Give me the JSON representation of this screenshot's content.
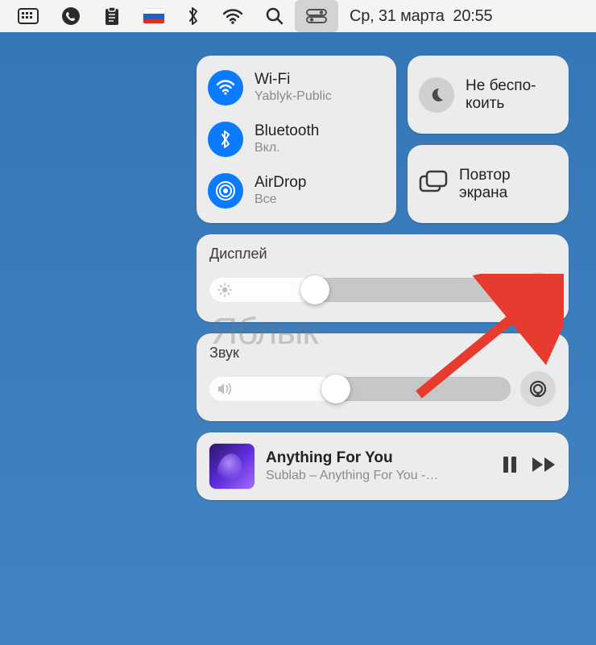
{
  "menubar": {
    "date": "Ср, 31 марта",
    "time": "20:55"
  },
  "control_center": {
    "connectivity": {
      "wifi": {
        "title": "Wi-Fi",
        "subtitle": "Yablyk-Public"
      },
      "bluetooth": {
        "title": "Bluetooth",
        "subtitle": "Вкл."
      },
      "airdrop": {
        "title": "AirDrop",
        "subtitle": "Все"
      }
    },
    "dnd": {
      "label": "Не беспо-\nкоить"
    },
    "screen_mirror": {
      "label": "Повтор\nэкрана"
    },
    "display": {
      "title": "Дисплей",
      "brightness_pct": 35
    },
    "sound": {
      "title": "Звук",
      "volume_pct": 42
    },
    "now_playing": {
      "title": "Anything For You",
      "subtitle": "Sublab – Anything For You -…"
    }
  },
  "watermark": "Яблык"
}
